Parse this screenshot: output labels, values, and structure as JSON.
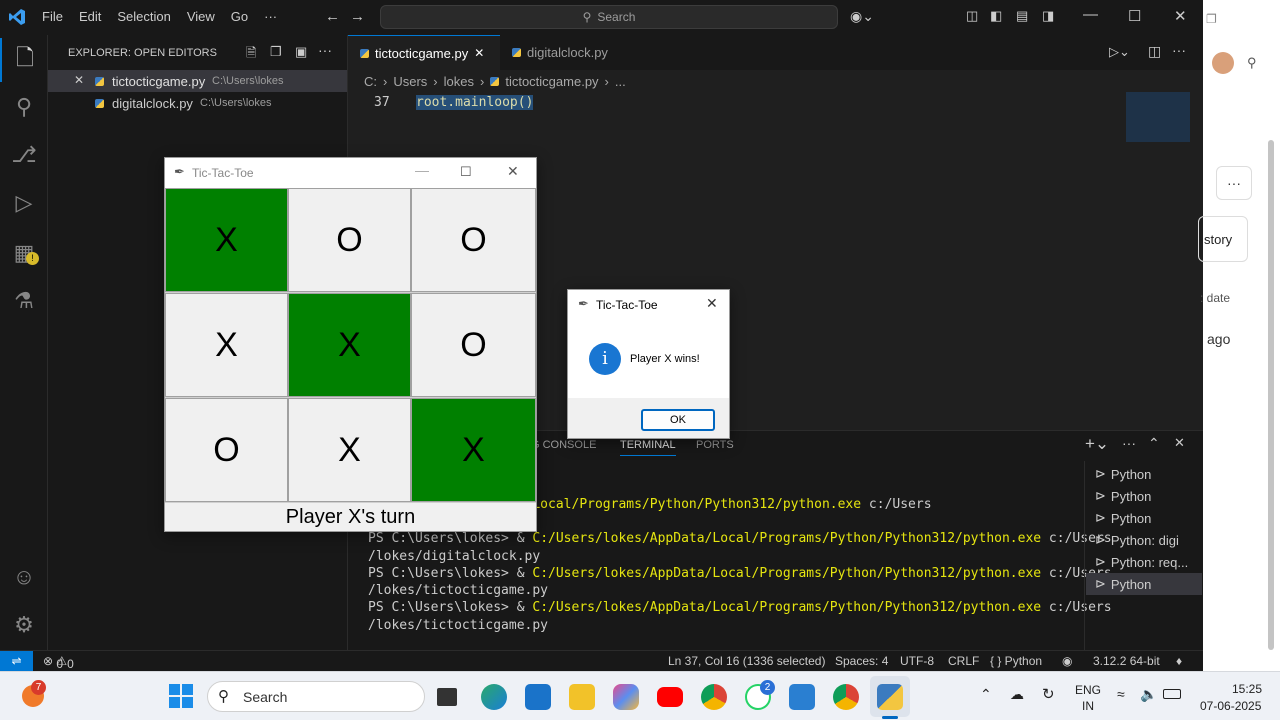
{
  "titlebar": {
    "menus": [
      "File",
      "Edit",
      "Selection",
      "View",
      "Go",
      "···"
    ],
    "search_placeholder": "Search"
  },
  "sidebar": {
    "header": "EXPLORER: OPEN EDITORS",
    "open_editors": [
      {
        "name": "tictocticgame.py",
        "path": "C:\\Users\\lokes"
      },
      {
        "name": "digitalclock.py",
        "path": "C:\\Users\\lokes"
      }
    ]
  },
  "editor": {
    "tabs": [
      {
        "label": "tictocticgame.py"
      },
      {
        "label": "digitalclock.py"
      }
    ],
    "breadcrumb": [
      "C:",
      "Users",
      "lokes",
      "tictocticgame.py",
      "..."
    ],
    "line_number": "37",
    "code_line": "root.mainloop()"
  },
  "panel": {
    "tabs": [
      "G CONSOLE",
      "TERMINAL",
      "PORTS"
    ],
    "active_tab": "TERMINAL",
    "lines": [
      {
        "prefix": "",
        "yellow": "/Users/lokes/AppData/Local/Programs/Python/Python312/python.exe",
        "suffix": " c:/Users"
      },
      {
        "prefix": "PS C:\\Users\\lokes> & ",
        "yellow": "C:/Users/lokes/AppData/Local/Programs/Python/Python312/python.exe",
        "suffix": " c:/Users"
      },
      {
        "prefix": "/lokes/digitalclock.py",
        "yellow": "",
        "suffix": ""
      },
      {
        "prefix": "PS C:\\Users\\lokes> & ",
        "yellow": "C:/Users/lokes/AppData/Local/Programs/Python/Python312/python.exe",
        "suffix": " c:/Users"
      },
      {
        "prefix": "/lokes/tictocticgame.py",
        "yellow": "",
        "suffix": ""
      },
      {
        "prefix": "PS C:\\Users\\lokes> & ",
        "yellow": "C:/Users/lokes/AppData/Local/Programs/Python/Python312/python.exe",
        "suffix": " c:/Users"
      },
      {
        "prefix": "/lokes/tictocticgame.py",
        "yellow": "",
        "suffix": ""
      }
    ],
    "terminals": [
      "Python",
      "Python",
      "Python",
      "Python: digi",
      "Python: req...",
      "Python"
    ]
  },
  "statusbar": {
    "problems": "0",
    "warnings": "0",
    "cursor": "Ln 37, Col 16 (1336 selected)",
    "spaces": "Spaces: 4",
    "encoding": "UTF-8",
    "eol": "CRLF",
    "language": "{ } Python",
    "interpreter": "3.12.2 64-bit"
  },
  "ttt": {
    "title": "Tic-Tac-Toe",
    "board": [
      "X",
      "O",
      "O",
      "X",
      "X",
      "O",
      "O",
      "X",
      "X"
    ],
    "winning_cells": [
      0,
      4,
      8
    ],
    "status": "Player X's turn"
  },
  "msgbox": {
    "title": "Tic-Tac-Toe",
    "message": "Player X wins!",
    "ok_label": "OK"
  },
  "browser": {
    "history_label": "story",
    "date_label": ": date",
    "ago_label": "ago"
  },
  "taskbar": {
    "search_placeholder": "Search",
    "whatsapp_badge": "2",
    "notification_badge": "7",
    "lang_line1": "ENG",
    "lang_line2": "IN",
    "time": "15:25",
    "date": "07-06-2025"
  },
  "colors": {
    "win_cell": "#008000",
    "accent": "#0078d4",
    "terminal_yellow": "#e5e510"
  }
}
